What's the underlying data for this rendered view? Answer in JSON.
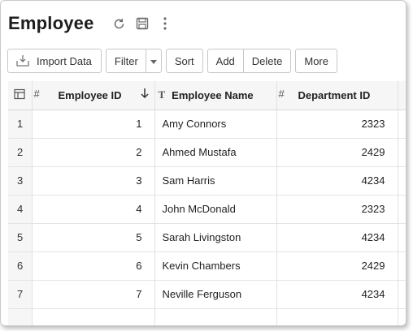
{
  "header": {
    "title": "Employee"
  },
  "toolbar": {
    "import_label": "Import Data",
    "filter_label": "Filter",
    "sort_label": "Sort",
    "add_label": "Add",
    "delete_label": "Delete",
    "more_label": "More"
  },
  "table": {
    "columns": [
      {
        "type_icon": "#",
        "label": "Employee ID",
        "sort": "descending"
      },
      {
        "type_icon": "T",
        "label": "Employee Name"
      },
      {
        "type_icon": "#",
        "label": "Department ID"
      }
    ],
    "rows": [
      {
        "num": "1",
        "id": "1",
        "name": "Amy Connors",
        "dept": "2323"
      },
      {
        "num": "2",
        "id": "2",
        "name": "Ahmed Mustafa",
        "dept": "2429"
      },
      {
        "num": "3",
        "id": "3",
        "name": "Sam Harris",
        "dept": "4234"
      },
      {
        "num": "4",
        "id": "4",
        "name": "John McDonald",
        "dept": "2323"
      },
      {
        "num": "5",
        "id": "5",
        "name": "Sarah Livingston",
        "dept": "4234"
      },
      {
        "num": "6",
        "id": "6",
        "name": "Kevin Chambers",
        "dept": "2429"
      },
      {
        "num": "7",
        "id": "7",
        "name": "Neville Ferguson",
        "dept": "4234"
      }
    ]
  },
  "icons": {
    "refresh": "refresh-icon",
    "save": "save-icon",
    "more": "more-vertical-icon",
    "import": "import-icon",
    "caret": "caret-down-icon",
    "table_settings": "table-settings-icon",
    "sort": "sort-descending-icon"
  }
}
